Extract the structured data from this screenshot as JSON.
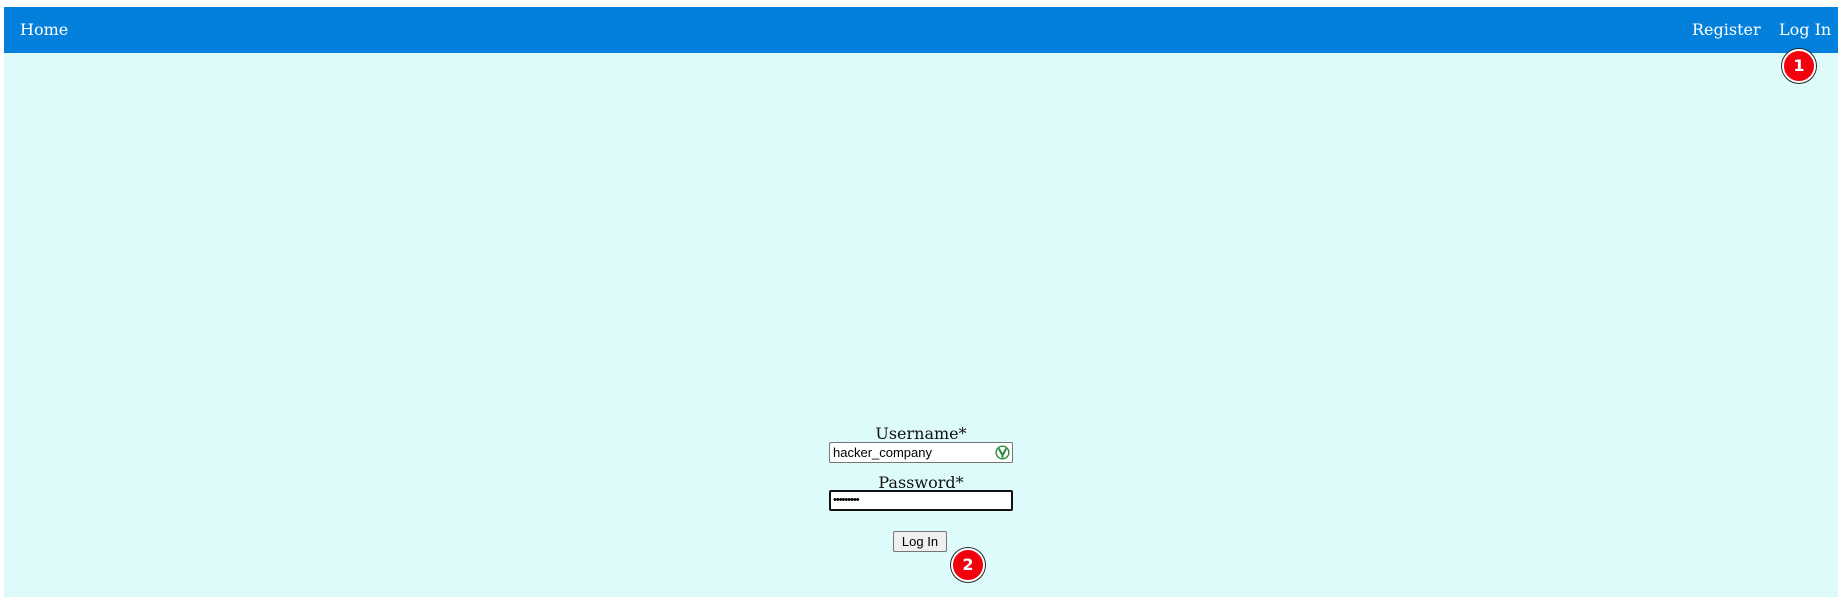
{
  "nav": {
    "home": "Home",
    "register": "Register",
    "login": "Log In"
  },
  "form": {
    "username_label": "Username*",
    "username_value": "hacker_company",
    "password_label": "Password*",
    "password_value": "•••••••••",
    "submit_label": "Log In"
  },
  "markers": [
    "1",
    "2"
  ],
  "colors": {
    "navbar": "#0380dc",
    "page_background": "#ddfbfb",
    "marker": "#f2000c"
  },
  "icons": {
    "username_field": "password-manager-icon"
  }
}
